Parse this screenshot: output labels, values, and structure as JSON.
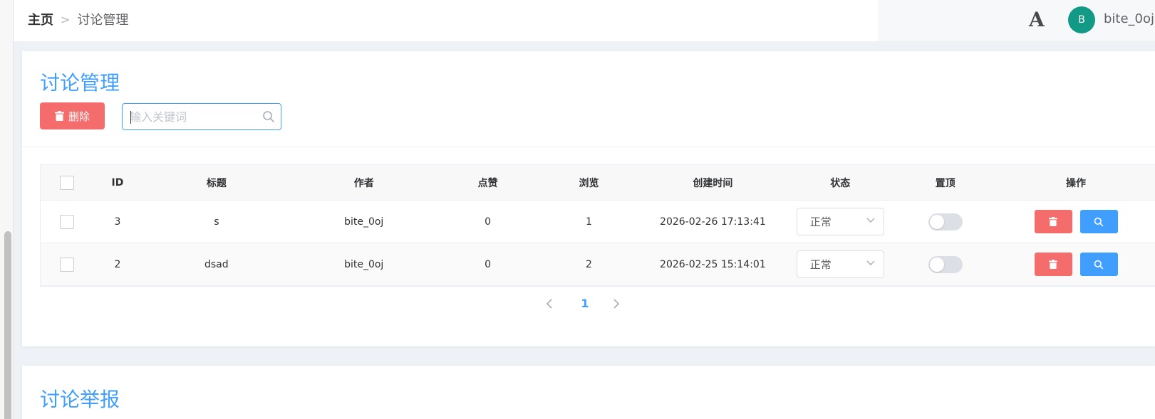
{
  "breadcrumb": {
    "home": "主页",
    "separator": ">",
    "current": "讨论管理"
  },
  "header": {
    "font_icon_glyph": "A",
    "avatar_letter": "B",
    "username": "bite_0oj"
  },
  "discussion_card": {
    "title": "讨论管理",
    "delete_label": "删除",
    "search_placeholder": "输入关键词",
    "search_value": ""
  },
  "table": {
    "columns": [
      "",
      "ID",
      "标题",
      "作者",
      "点赞",
      "浏览",
      "创建时间",
      "状态",
      "置顶",
      "操作"
    ],
    "rows": [
      {
        "id": "3",
        "title": "s",
        "author": "bite_0oj",
        "likes": "0",
        "views": "1",
        "created": "2026-02-26 17:13:41",
        "status": "正常",
        "pinned": false
      },
      {
        "id": "2",
        "title": "dsad",
        "author": "bite_0oj",
        "likes": "0",
        "views": "2",
        "created": "2026-02-25 15:14:01",
        "status": "正常",
        "pinned": false
      }
    ]
  },
  "pagination": {
    "current_page": "1"
  },
  "report_card": {
    "title": "讨论举报"
  },
  "colors": {
    "primary": "#409eff",
    "danger": "#f56c6c",
    "avatar": "#139a86",
    "switch_off": "#dcdfe6"
  },
  "icons": [
    "trash-icon",
    "search-icon",
    "chevron-down-icon",
    "chevron-left-icon",
    "chevron-right-icon",
    "font-size-icon"
  ]
}
